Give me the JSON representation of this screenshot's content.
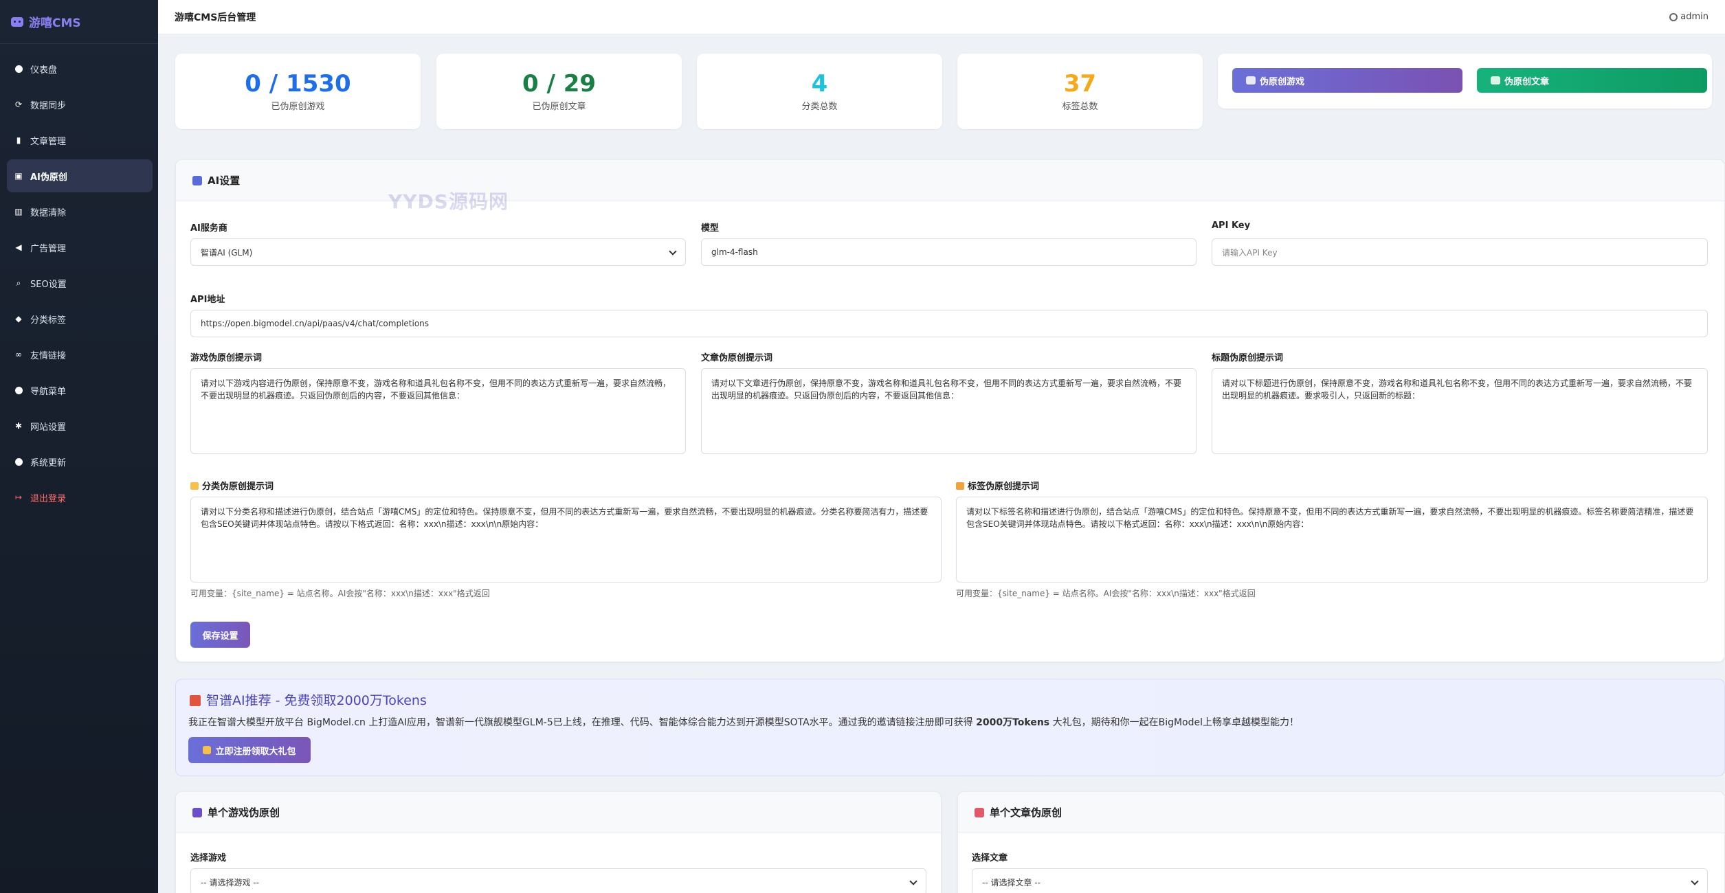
{
  "brand": {
    "title": "游嘻CMS",
    "icon": "gamepad-icon",
    "color": "#8a7ff0"
  },
  "header": {
    "title": "游嘻CMS后台管理",
    "user": "admin"
  },
  "sidebar": {
    "items": [
      {
        "label": "仪表盘",
        "icon": "dashboard-icon"
      },
      {
        "label": "数据同步",
        "icon": "sync-icon"
      },
      {
        "label": "文章管理",
        "icon": "document-icon"
      },
      {
        "label": "AI伪原创",
        "icon": "robot-icon",
        "active": true
      },
      {
        "label": "数据清除",
        "icon": "trash-icon"
      },
      {
        "label": "广告管理",
        "icon": "megaphone-icon"
      },
      {
        "label": "SEO设置",
        "icon": "search-icon"
      },
      {
        "label": "分类标签",
        "icon": "tag-icon"
      },
      {
        "label": "友情链接",
        "icon": "link-icon"
      },
      {
        "label": "导航菜单",
        "icon": "compass-icon"
      },
      {
        "label": "网站设置",
        "icon": "gear-icon"
      },
      {
        "label": "系统更新",
        "icon": "update-icon"
      },
      {
        "label": "退出登录",
        "icon": "logout-icon",
        "danger": true
      }
    ]
  },
  "stats": [
    {
      "value": "0 / 1530",
      "label": "已伪原创游戏",
      "color": "#1e6fe6"
    },
    {
      "value": "0 / 29",
      "label": "已伪原创文章",
      "color": "#1a7f45"
    },
    {
      "value": "4",
      "label": "分类总数",
      "color": "#1fc3d9"
    },
    {
      "value": "37",
      "label": "标签总数",
      "color": "#f2a91a"
    }
  ],
  "actions": {
    "game_btn": "伪原创游戏",
    "article_btn": "伪原创文章"
  },
  "ai_settings": {
    "title": "AI设置",
    "watermark": "YYDS源码网",
    "provider_label": "AI服务商",
    "provider_value": "智谱AI (GLM)",
    "model_label": "模型",
    "model_value": "glm-4-flash",
    "apikey_label": "API Key",
    "apikey_placeholder": "请输入API Key",
    "apiurl_label": "API地址",
    "apiurl_value": "https://open.bigmodel.cn/api/paas/v4/chat/completions",
    "game_prompt_label": "游戏伪原创提示词",
    "game_prompt": "请对以下游戏内容进行伪原创，保持原意不变，游戏名称和道具礼包名称不变，但用不同的表达方式重新写一遍，要求自然流畅，不要出现明显的机器痕迹。只返回伪原创后的内容，不要返回其他信息：",
    "article_prompt_label": "文章伪原创提示词",
    "article_prompt": "请对以下文章进行伪原创，保持原意不变，游戏名称和道具礼包名称不变，但用不同的表达方式重新写一遍，要求自然流畅，不要出现明显的机器痕迹。只返回伪原创后的内容，不要返回其他信息：",
    "title_prompt_label": "标题伪原创提示词",
    "title_prompt": "请对以下标题进行伪原创，保持原意不变，游戏名称和道具礼包名称不变，但用不同的表达方式重新写一遍，要求自然流畅，不要出现明显的机器痕迹。要求吸引人，只返回新的标题：",
    "category_prompt_label": "分类伪原创提示词",
    "category_prompt": "请对以下分类名称和描述进行伪原创，结合站点「游嘻CMS」的定位和特色。保持原意不变，但用不同的表达方式重新写一遍，要求自然流畅，不要出现明显的机器痕迹。分类名称要简洁有力，描述要包含SEO关键词并体现站点特色。请按以下格式返回：名称：xxx\\n描述：xxx\\n\\n原始内容：",
    "category_hint": "可用变量：{site_name} = 站点名称。AI会按\"名称：xxx\\n描述：xxx\"格式返回",
    "tag_prompt_label": "标签伪原创提示词",
    "tag_prompt": "请对以下标签名称和描述进行伪原创，结合站点「游嘻CMS」的定位和特色。保持原意不变，但用不同的表达方式重新写一遍，要求自然流畅，不要出现明显的机器痕迹。标签名称要简洁精准，描述要包含SEO关键词并体现站点特色。请按以下格式返回：名称：xxx\\n描述：xxx\\n\\n原始内容：",
    "tag_hint": "可用变量：{site_name} = 站点名称。AI会按\"名称：xxx\\n描述：xxx\"格式返回",
    "save_btn": "保存设置"
  },
  "promo": {
    "title": "智谱AI推荐 - 免费领取2000万Tokens",
    "desc_pre": "我正在智谱大模型开放平台 BigModel.cn 上打造AI应用，智谱新一代旗舰模型GLM-5已上线，在推理、代码、智能体综合能力达到开源模型SOTA水平。通过我的邀请链接注册即可获得 ",
    "desc_bold": "2000万Tokens",
    "desc_post": " 大礼包，期待和你一起在BigModel上畅享卓越模型能力！",
    "btn": "立即注册领取大礼包"
  },
  "single_game": {
    "title": "单个游戏伪原创",
    "select_label": "选择游戏",
    "select_value": "-- 请选择游戏 --"
  },
  "single_article": {
    "title": "单个文章伪原创",
    "select_label": "选择文章",
    "select_value": "-- 请选择文章 --"
  }
}
